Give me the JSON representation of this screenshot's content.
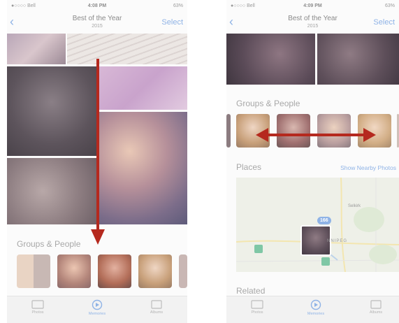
{
  "left_screen": {
    "status": {
      "carrier": "●○○○○ Bell",
      "time": "4:08 PM",
      "battery": "63%"
    },
    "nav": {
      "back": "‹",
      "title": "Best of the Year",
      "subtitle": "2015",
      "select": "Select"
    },
    "section": {
      "groups": "Groups & People"
    },
    "tabs": {
      "photos": "Photos",
      "memories": "Memories",
      "albums": "Albums"
    }
  },
  "right_screen": {
    "status": {
      "carrier": "●○○○○ Bell",
      "time": "4:09 PM",
      "battery": "63%"
    },
    "nav": {
      "back": "‹",
      "title": "Best of the Year",
      "subtitle": "2015",
      "select": "Select"
    },
    "section": {
      "groups": "Groups & People",
      "places": "Places",
      "show_nearby": "Show Nearby Photos",
      "related": "Related"
    },
    "map": {
      "badge": "166",
      "city": "NNIPEG",
      "town": "Selkirk"
    },
    "tabs": {
      "photos": "Photos",
      "memories": "Memories",
      "albums": "Albums"
    }
  },
  "colors": {
    "arrow": "#b5291e",
    "accent": "#8fb3e6"
  }
}
